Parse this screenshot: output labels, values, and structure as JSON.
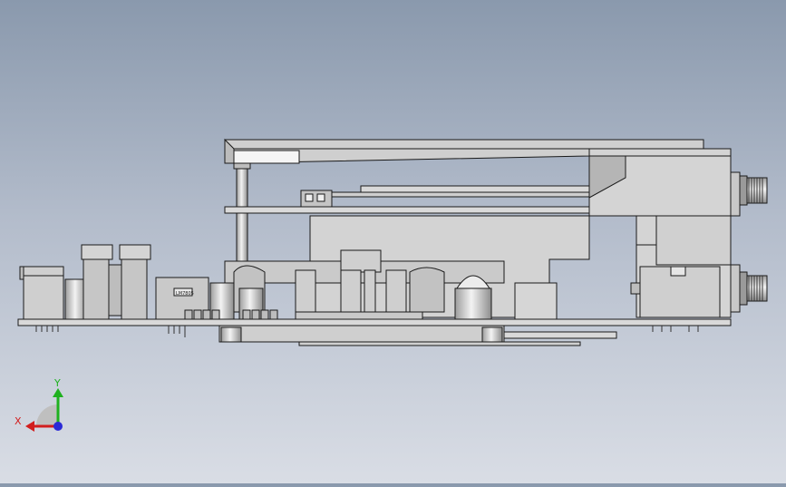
{
  "view": {
    "background_top": "#8a99ad",
    "background_bottom": "#d9dde5"
  },
  "model": {
    "part_color": "#d6d6d6",
    "edge_color": "#1a1a1a",
    "highlight_color": "#f2f2f2",
    "shadow_color": "#a8a8a8",
    "component_label": "LM7805"
  },
  "triad": {
    "x_label": "X",
    "y_label": "Y",
    "x_color": "#d21e1e",
    "y_color": "#1fb11f",
    "z_color": "#2a2ad6",
    "icon": "coordinate-triad-icon"
  }
}
